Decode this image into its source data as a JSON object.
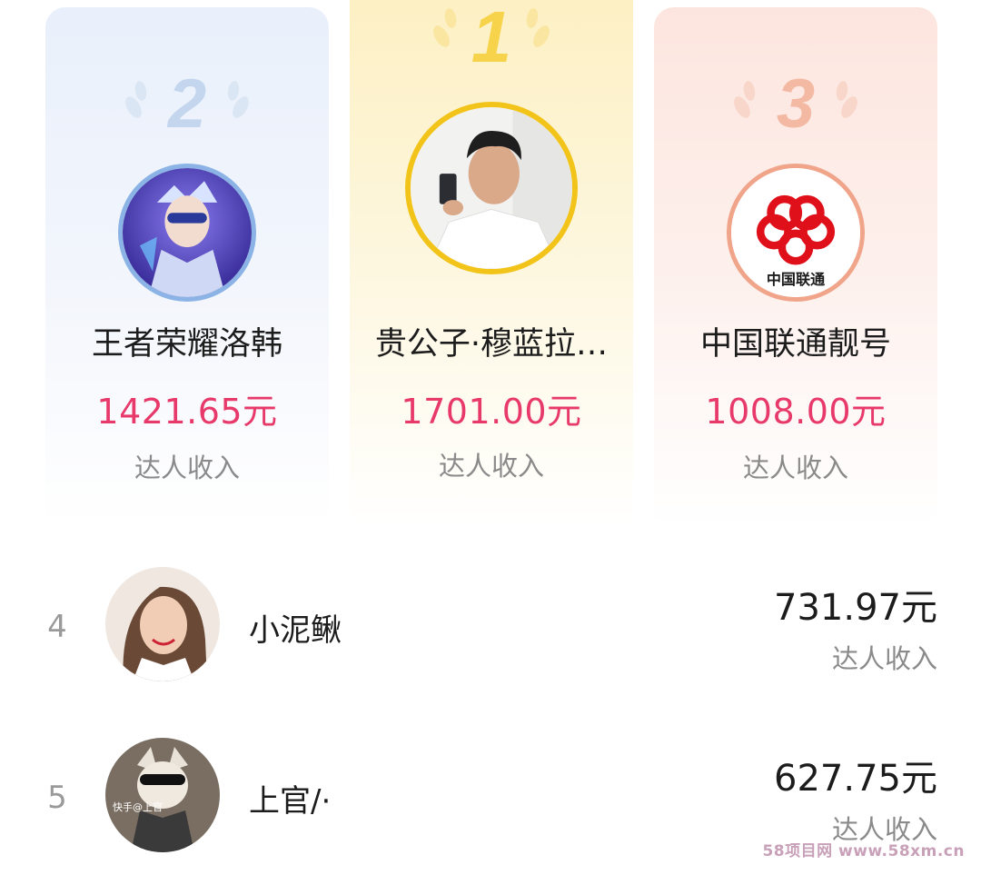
{
  "podium": [
    {
      "rank": "2",
      "name": "王者荣耀洛韩",
      "amount": "1421.65元",
      "label": "达人收入"
    },
    {
      "rank": "1",
      "name": "贵公子·穆蓝拉…",
      "amount": "1701.00元",
      "label": "达人收入"
    },
    {
      "rank": "3",
      "name": "中国联通靓号",
      "amount": "1008.00元",
      "label": "达人收入",
      "avatar_text": "中国联通"
    }
  ],
  "list": [
    {
      "rank": "4",
      "name": "小泥鳅",
      "amount": "731.97元",
      "label": "达人收入"
    },
    {
      "rank": "5",
      "name": "上官/·",
      "amount": "627.75元",
      "label": "达人收入",
      "avatar_text": "快手@上官"
    }
  ],
  "watermark": "58项目网 www.58xm.cn",
  "colors": {
    "amount_pink": "#e8396b",
    "gold": "#f2c419",
    "silver_blue": "#8bb3e6",
    "bronze": "#f0a58a"
  }
}
